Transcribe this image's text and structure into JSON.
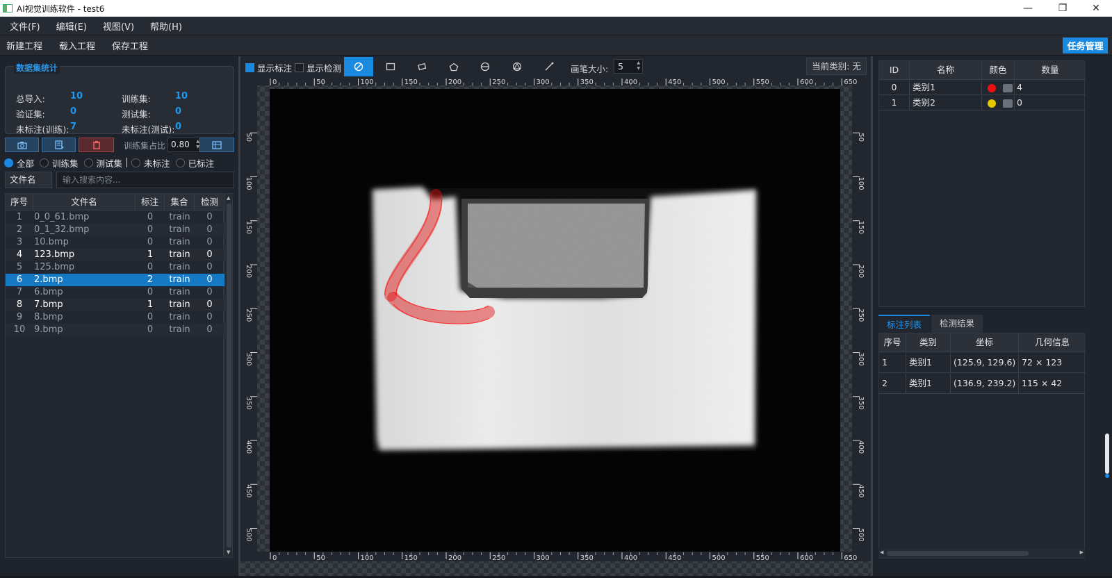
{
  "window": {
    "title": "AI视觉训练软件 - test6",
    "controls": [
      "minimize-icon",
      "restore-icon",
      "close-icon"
    ]
  },
  "menu": [
    "文件(F)",
    "编辑(E)",
    "视图(V)",
    "帮助(H)"
  ],
  "toolbar": {
    "new_project": "新建工程",
    "load_project": "载入工程",
    "save_project": "保存工程",
    "task_manage": "任务管理"
  },
  "stats": {
    "title": "数据集统计",
    "total_label": "总导入:",
    "total_value": "10",
    "train_label": "训练集:",
    "train_value": "10",
    "val_label": "验证集:",
    "val_value": "0",
    "test_label": "测试集:",
    "test_value": "0",
    "unlabeled_train_label": "未标注(训练):",
    "unlabeled_train_value": "7",
    "unlabeled_test_label": "未标注(测试):",
    "unlabeled_test_value": "0"
  },
  "actions": {
    "buttons": [
      "camera-icon",
      "export-icon",
      "trash-icon",
      "table-icon"
    ],
    "ratio_label": "训练集占比",
    "ratio_value": "0.80"
  },
  "filters": {
    "all": "全部",
    "train": "训练集",
    "test": "测试集",
    "unlabeled": "未标注",
    "labeled": "已标注",
    "selected": "全部"
  },
  "search": {
    "field_label": "文件名",
    "placeholder": "输入搜索内容..."
  },
  "file_table": {
    "headers": [
      "序号",
      "文件名",
      "标注",
      "集合",
      "检测"
    ],
    "rows": [
      [
        "1",
        "0_0_61.bmp",
        "0",
        "train",
        "0"
      ],
      [
        "2",
        "0_1_32.bmp",
        "0",
        "train",
        "0"
      ],
      [
        "3",
        "10.bmp",
        "0",
        "train",
        "0"
      ],
      [
        "4",
        "123.bmp",
        "1",
        "train",
        "0"
      ],
      [
        "5",
        "125.bmp",
        "0",
        "train",
        "0"
      ],
      [
        "6",
        "2.bmp",
        "2",
        "train",
        "0"
      ],
      [
        "7",
        "6.bmp",
        "0",
        "train",
        "0"
      ],
      [
        "8",
        "7.bmp",
        "1",
        "train",
        "0"
      ],
      [
        "9",
        "8.bmp",
        "0",
        "train",
        "0"
      ],
      [
        "10",
        "9.bmp",
        "0",
        "train",
        "0"
      ]
    ],
    "selected_index": 5
  },
  "canvas_toolbar": {
    "show_annotations": "显示标注",
    "show_annotations_checked": true,
    "show_detections": "显示检测",
    "show_detections_checked": false,
    "tools": [
      "brush-eraser-icon",
      "rectangle-icon",
      "rotated-rect-icon",
      "polygon-icon",
      "circle-icon",
      "triangle-icon",
      "line-icon"
    ],
    "active_tool": "brush-eraser-icon",
    "pen_size_label": "画笔大小:",
    "pen_size_value": "5",
    "current_class": "当前类别: 无"
  },
  "ruler": {
    "ticks": [
      "0",
      "50",
      "100",
      "150",
      "200",
      "250",
      "300",
      "350",
      "400",
      "450",
      "500",
      "550",
      "600",
      "650"
    ],
    "v_ticks": [
      "50",
      "100",
      "150",
      "200",
      "250",
      "300",
      "350",
      "400",
      "450",
      "500"
    ]
  },
  "class_table": {
    "headers": [
      "ID",
      "名称",
      "颜色",
      "数量"
    ],
    "rows": [
      {
        "id": "0",
        "name": "类别1",
        "color": "#ee1111",
        "count": "4"
      },
      {
        "id": "1",
        "name": "类别2",
        "color": "#e6c700",
        "count": "0"
      }
    ]
  },
  "tabs": [
    "标注列表",
    "检测结果"
  ],
  "annotation_table": {
    "headers": [
      "序号",
      "类别",
      "坐标",
      "几何信息"
    ],
    "rows": [
      [
        "1",
        "类别1",
        "(125.9, 129.6)",
        "72 × 123"
      ],
      [
        "2",
        "类别1",
        "(136.9, 239.2)",
        "115 × 42"
      ]
    ]
  },
  "colors": {
    "accent": "#1a8ae0",
    "annotation": "#ee1111"
  }
}
